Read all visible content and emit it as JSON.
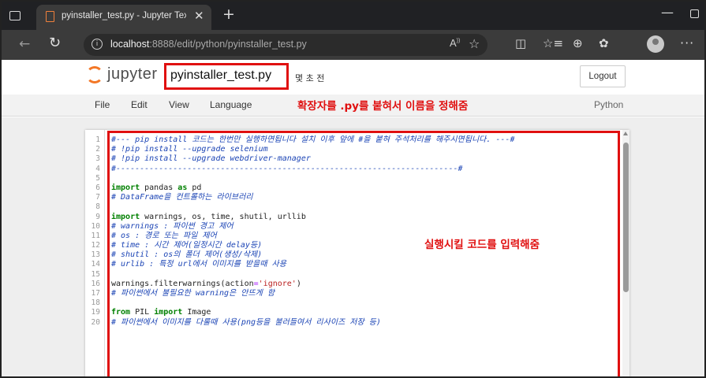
{
  "browser": {
    "tab_title": "pyinstaller_test.py - Jupyter Text E",
    "tab_close": "✕",
    "new_tab": "+",
    "url_host": "localhost",
    "url_path": ":8888/edit/python/pyinstaller_test.py",
    "read_aloud": "A",
    "minimize": "—"
  },
  "jupyter": {
    "logo_text": "jupyter",
    "filename": "pyinstaller_test.py",
    "save_status": "몇 초 전",
    "logout_label": "Logout",
    "menu": [
      "File",
      "Edit",
      "View",
      "Language"
    ],
    "language_mode": "Python"
  },
  "annotations": {
    "rename_note": "확장자를 .py를 붙혀서 이름을 정해줌",
    "code_note": "실행시킬 코드를 입력해줌"
  },
  "colors": {
    "annotation_red": "#e01010",
    "jupyter_orange": "#f37726",
    "comment_blue": "#1b44b5",
    "keyword_green": "#008000"
  },
  "code": {
    "lines": [
      {
        "n": "1",
        "text": "#--- pip install 코드는 한번만 실행하면됩니다 설치 이후 앞에 #을 붙혀 주석처리를 해주시면됩니다. ---#",
        "type": "comment"
      },
      {
        "n": "2",
        "text": "# !pip install --upgrade selenium",
        "type": "comment"
      },
      {
        "n": "3",
        "text": "# !pip install --upgrade webdriver-manager",
        "type": "comment"
      },
      {
        "n": "4",
        "text": "#------------------------------------------------------------------------#",
        "type": "comment"
      },
      {
        "n": "5",
        "text": "",
        "type": "blank"
      },
      {
        "n": "6",
        "kw1": "import",
        "mid": " pandas ",
        "kw2": "as",
        "tail": " pd",
        "type": "import"
      },
      {
        "n": "7",
        "text": "# DataFrame을 컨트롤하는 라이브러리",
        "type": "comment"
      },
      {
        "n": "8",
        "text": "",
        "type": "blank"
      },
      {
        "n": "9",
        "kw1": "import",
        "mid": " warnings, os, time, shutil, urllib",
        "kw2": "",
        "tail": "",
        "type": "import"
      },
      {
        "n": "10",
        "text": "# warnings : 파이썬 경고 제어",
        "type": "comment"
      },
      {
        "n": "11",
        "text": "# os : 경로 또는 파일 제어",
        "type": "comment"
      },
      {
        "n": "12",
        "text": "# time : 시간 제어(일정시간 delay등)",
        "type": "comment"
      },
      {
        "n": "13",
        "text": "# shutil : os의 폴더 제어(생성/삭제)",
        "type": "comment"
      },
      {
        "n": "14",
        "text": "# urlib : 특정 url에서 이미지를 받을때 사용",
        "type": "comment"
      },
      {
        "n": "15",
        "text": "",
        "type": "blank"
      },
      {
        "n": "16",
        "pre": "warnings.filterwarnings(action",
        "eq": "=",
        "str": "'ignore'",
        "post": ")",
        "type": "call"
      },
      {
        "n": "17",
        "text": "# 파이썬에서 불필요한 warning은 안뜨게 함",
        "type": "comment"
      },
      {
        "n": "18",
        "text": "",
        "type": "blank"
      },
      {
        "n": "19",
        "kw1": "from",
        "mid": " PIL ",
        "kw2": "import",
        "tail": " Image",
        "type": "import"
      },
      {
        "n": "20",
        "text": "# 파이썬에서 이미지를 다룰때 사용(png등을 불러들여서 리사이즈 저장 등)",
        "type": "comment"
      }
    ]
  }
}
